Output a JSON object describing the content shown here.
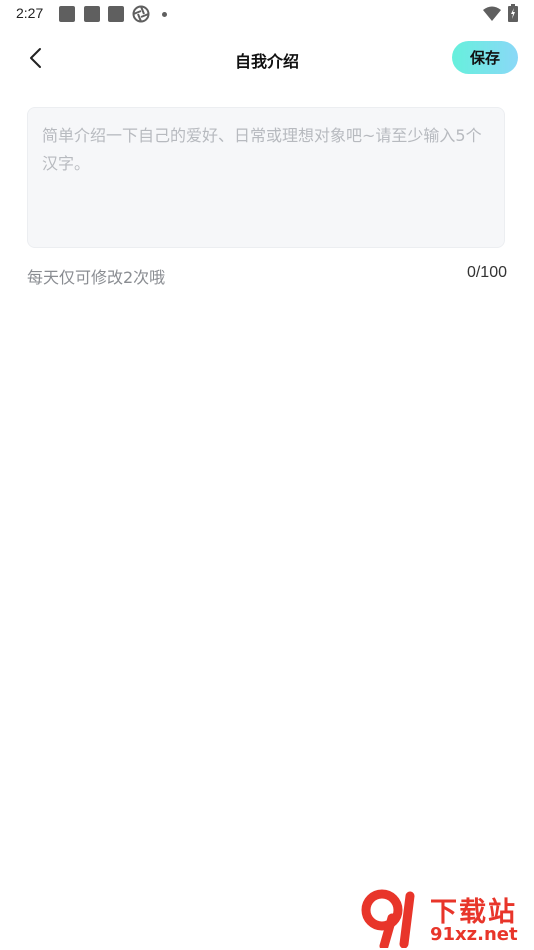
{
  "status_bar": {
    "time": "2:27",
    "icons": [
      "notification-icon",
      "notification-icon",
      "notification-icon",
      "aperture-icon",
      "dot-icon",
      "wifi-icon",
      "battery-icon"
    ]
  },
  "header": {
    "title": "自我介绍",
    "back_icon": "chevron-left-icon",
    "save_label": "保存"
  },
  "intro": {
    "value": "",
    "placeholder": "简单介绍一下自己的爱好、日常或理想对象吧~请至少输入5个汉字。",
    "limit_hint": "每天仅可修改2次哦",
    "counter": "0/100"
  },
  "colors": {
    "save_gradient_start": "#66f0dc",
    "save_gradient_end": "#8ad8f7",
    "textarea_bg": "#f6f7f9",
    "watermark": "#e8352a"
  },
  "watermark": {
    "title": "下载站",
    "url": "91xz.net"
  }
}
